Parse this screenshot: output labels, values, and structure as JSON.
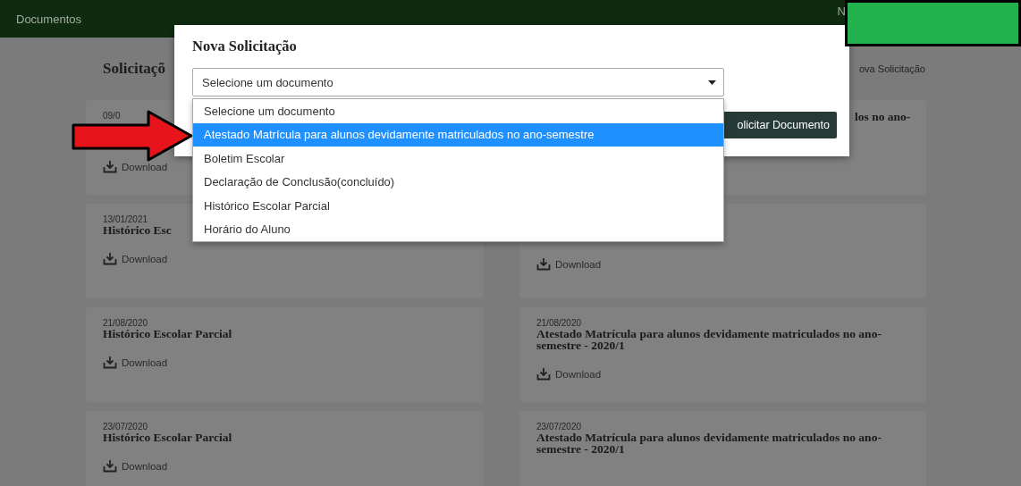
{
  "header": {
    "title": "Documentos",
    "user": "N"
  },
  "page": {
    "title": "Solicitaçõ",
    "new_request_link": "ova Solicitação"
  },
  "cards": [
    {
      "date": "09/0",
      "download": "Download"
    },
    {
      "title": "los no ano-"
    },
    {
      "date": "13/01/2021",
      "title": "Histórico Esc",
      "download": "Download"
    },
    {
      "download": "Download"
    },
    {
      "date": "21/08/2020",
      "title": "Histórico Escolar Parcial",
      "download": "Download"
    },
    {
      "date": "21/08/2020",
      "title": "Atestado Matrícula para alunos devidamente matriculados no ano-semestre - 2020/1",
      "download": "Download"
    },
    {
      "date": "23/07/2020",
      "title": "Histórico Escolar Parcial",
      "download": "Download"
    },
    {
      "date": "23/07/2020",
      "title": "Atestado Matrícula para alunos devidamente matriculados no ano-semestre - 2020/1"
    }
  ],
  "modal": {
    "title": "Nova Solicitação",
    "select_value": "Selecione um documento",
    "button": "olicitar Documento",
    "options": [
      {
        "label": "Selecione um documento",
        "selected": false
      },
      {
        "label": "Atestado Matrícula para alunos devidamente matriculados no ano-semestre",
        "selected": true
      },
      {
        "label": "Boletim Escolar",
        "selected": false
      },
      {
        "label": "Declaração de Conclusão(concluído)",
        "selected": false
      },
      {
        "label": "Histórico Escolar Parcial",
        "selected": false
      },
      {
        "label": "Horário do Aluno",
        "selected": false
      }
    ]
  }
}
